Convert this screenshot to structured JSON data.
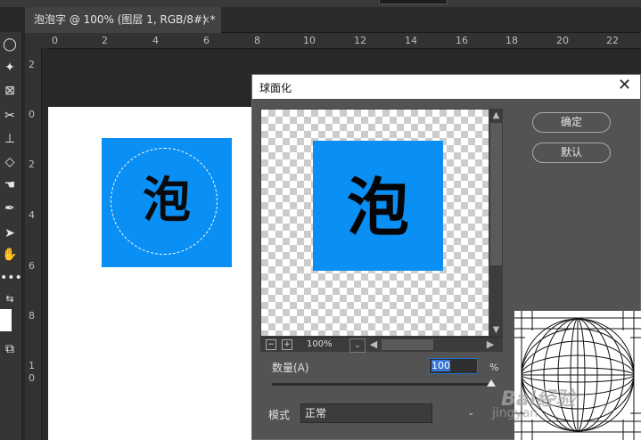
{
  "document_tab": {
    "title": "泡泡字 @ 100% (图层 1, RGB/8#) *",
    "close": "×"
  },
  "ruler_top": [
    "0",
    "2",
    "4",
    "6",
    "8",
    "10",
    "12",
    "14",
    "16",
    "18",
    "20",
    "22"
  ],
  "ruler_left": [
    "2",
    "0",
    "2",
    "4",
    "6",
    "8",
    "1",
    "0"
  ],
  "canvas": {
    "glyph": "泡",
    "fill_color": "#0a8ff4"
  },
  "dialog": {
    "title": "球面化",
    "close": "✕",
    "preview_glyph": "泡",
    "zoom": "100%",
    "ok_label": "确定",
    "reset_label": "默认",
    "amount_label": "数量(A)",
    "amount_value": "100",
    "amount_unit": "%",
    "amount_slider": {
      "min": -100,
      "max": 100,
      "value": 100
    },
    "mode_label": "模式",
    "mode_value": "正常"
  },
  "watermark": {
    "text": "Bai经验",
    "sub": "jingyan"
  },
  "icons": [
    "lasso-ellipse-icon",
    "magic-wand-icon",
    "crop-frame-icon",
    "healing-icon",
    "stamp-icon",
    "eraser-icon",
    "smudge-icon",
    "pen-icon",
    "path-select-icon",
    "hand-icon",
    "more-icon",
    "swap-colors-icon",
    "screen-mode-icon"
  ]
}
